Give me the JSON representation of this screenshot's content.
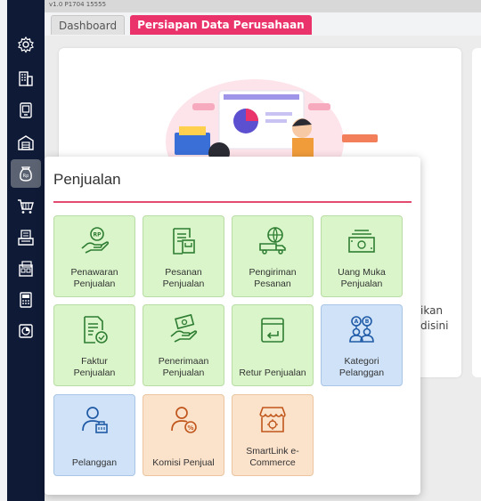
{
  "app": {
    "version": "v1.0 P1704 15555"
  },
  "tabs": [
    {
      "label": "Dashboard"
    },
    {
      "label": "Persiapan Data Perusahaan"
    }
  ],
  "background": {
    "text_right_1": "ikan",
    "text_right_2": "disini"
  },
  "sidebar": {
    "icons": [
      "gear-icon",
      "building-icon",
      "tablet-icon",
      "warehouse-icon",
      "sales-bag-icon",
      "cart-icon",
      "purchase-icon",
      "inventory-icon",
      "tax-icon",
      "report-icon"
    ],
    "active": "sales-bag-icon"
  },
  "popup": {
    "title": "Penjualan",
    "tiles": [
      {
        "label": "Penawaran\nPenjualan",
        "color": "green",
        "icon": "offer-hand-icon"
      },
      {
        "label": "Pesanan\nPenjualan",
        "color": "green",
        "icon": "order-doc-icon"
      },
      {
        "label": "Pengiriman\nPesanan",
        "color": "green",
        "icon": "delivery-truck-icon"
      },
      {
        "label": "Uang Muka\nPenjualan",
        "color": "green",
        "icon": "cash-icon"
      },
      {
        "label": "Faktur\nPenjualan",
        "color": "green",
        "icon": "invoice-icon"
      },
      {
        "label": "Penerimaan\nPenjualan",
        "color": "green",
        "icon": "receipt-money-icon"
      },
      {
        "label": "Retur Penjualan",
        "color": "green",
        "icon": "return-icon"
      },
      {
        "label": "Kategori\nPelanggan",
        "color": "blue",
        "icon": "customer-category-icon"
      },
      {
        "label": "Pelanggan",
        "color": "blue",
        "icon": "customer-icon"
      },
      {
        "label": "Komisi Penjual",
        "color": "orange",
        "icon": "commission-icon"
      },
      {
        "label": "SmartLink e-\nCommerce",
        "color": "orange",
        "icon": "store-icon"
      }
    ]
  },
  "colors": {
    "sidebar": "#0f1a36",
    "accent": "#e9336a",
    "green_tile": "#d9f5c9",
    "blue_tile": "#cfe2f8",
    "orange_tile": "#fbe2cb"
  }
}
